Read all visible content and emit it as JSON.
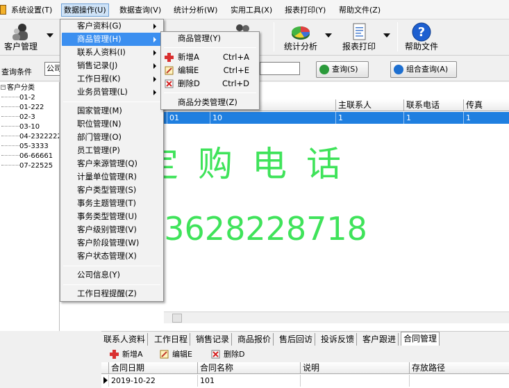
{
  "menubar": {
    "items": [
      {
        "label": "系统设置(T)"
      },
      {
        "label": "数据操作(U)"
      },
      {
        "label": "数据查询(V)"
      },
      {
        "label": "统计分析(W)"
      },
      {
        "label": "实用工具(X)"
      },
      {
        "label": "报表打印(Y)"
      },
      {
        "label": "帮助文件(Z)"
      }
    ]
  },
  "toolbar": {
    "customer_mgmt": "客户管理",
    "partial_label": "理",
    "stats": "统计分析",
    "report_print": "报表打印",
    "help": "帮助文件"
  },
  "query": {
    "label": "查询条件",
    "company_value": "公司",
    "query_button": "查询(S)",
    "combo_query_button": "组合查询(A)"
  },
  "tree": {
    "root": "客户分类",
    "nodes": [
      "01-2",
      "01-222",
      "02-3",
      "03-10",
      "04-2322222",
      "05-3333",
      "06-66661",
      "07-22525"
    ]
  },
  "grid": {
    "columns": [
      "主联系人",
      "联系电话",
      "传真"
    ],
    "row": {
      "col1": "01",
      "col2": "10",
      "contact": "1",
      "phone": "1",
      "fax": "1"
    }
  },
  "watermark": {
    "line1": "定购电话",
    "line2": "13628228718"
  },
  "bottom_tabs": {
    "tabs": [
      "联系人资料",
      "工作日程",
      "销售记录",
      "商品报价",
      "售后回访",
      "投诉反馈",
      "客户跟进",
      "合同管理"
    ],
    "active": "合同管理"
  },
  "sub_toolbar": {
    "new": "新增A",
    "edit": "编辑E",
    "delete": "删除D"
  },
  "sub_grid": {
    "columns": [
      "合同日期",
      "合同名称",
      "说明",
      "存放路径"
    ],
    "row": {
      "date": "2019-10-22",
      "name": "101",
      "desc": "",
      "path": ""
    }
  },
  "data_ops_menu": {
    "items": [
      {
        "label": "客户资料(G)"
      },
      {
        "label": "商品管理(H)"
      },
      {
        "label": "联系人资料(I)"
      },
      {
        "label": "销售记录(J)"
      },
      {
        "label": "工作日程(K)"
      },
      {
        "label": "业务员管理(L)"
      },
      {
        "label": "国家管理(M)"
      },
      {
        "label": "职位管理(N)"
      },
      {
        "label": "部门管理(O)"
      },
      {
        "label": "员工管理(P)"
      },
      {
        "label": "客户来源管理(Q)"
      },
      {
        "label": "计量单位管理(R)"
      },
      {
        "label": "客户类型管理(S)"
      },
      {
        "label": "事务主题管理(T)"
      },
      {
        "label": "事务类型管理(U)"
      },
      {
        "label": "客户级别管理(V)"
      },
      {
        "label": "客户阶段管理(W)"
      },
      {
        "label": "客户状态管理(X)"
      },
      {
        "label": "公司信息(Y)"
      },
      {
        "label": "工作日程提醒(Z)"
      }
    ]
  },
  "goods_submenu": {
    "items": [
      {
        "label": "商品管理(Y)",
        "shortcut": ""
      },
      {
        "label": "新增A",
        "shortcut": "Ctrl+A"
      },
      {
        "label": "编辑E",
        "shortcut": "Ctrl+E"
      },
      {
        "label": "删除D",
        "shortcut": "Ctrl+D"
      },
      {
        "label": "商品分类管理(Z)",
        "shortcut": ""
      }
    ]
  },
  "colors": {
    "selection": "#1f7fe0",
    "menu_highlight": "#3b8ff0",
    "watermark": "#3fe35a"
  }
}
